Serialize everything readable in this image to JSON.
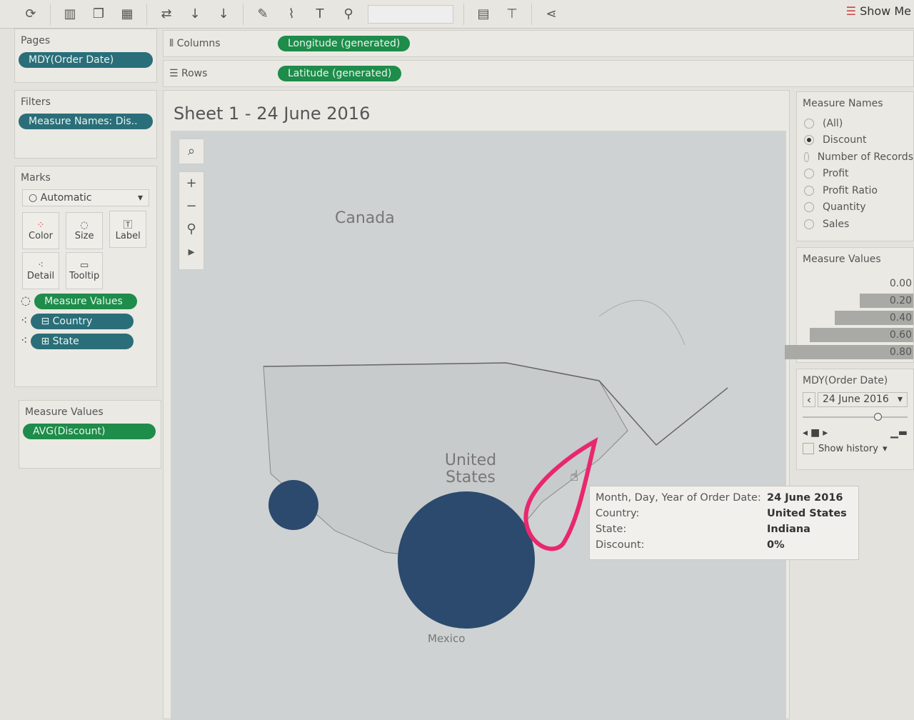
{
  "toolbar": {
    "icons": [
      "refresh-icon",
      "new-worksheet-icon",
      "duplicate-icon",
      "clear-sheet-icon",
      "swap-icon",
      "sort-asc-icon",
      "sort-desc-icon",
      "highlight-icon",
      "paperclip-icon",
      "text-icon",
      "pin-icon",
      "chart-type-icon",
      "presentation-icon",
      "share-icon"
    ],
    "show_me": "Show Me"
  },
  "pages": {
    "title": "Pages",
    "pill": "MDY(Order Date)"
  },
  "filters": {
    "title": "Filters",
    "pill": "Measure Names: Dis.."
  },
  "marks": {
    "title": "Marks",
    "type": "Automatic",
    "buttons": [
      "Color",
      "Size",
      "Label",
      "Detail",
      "Tooltip"
    ],
    "pills": [
      "Measure Values",
      "Country",
      "State"
    ]
  },
  "measure_values_card": {
    "title": "Measure Values",
    "pill": "AVG(Discount)"
  },
  "shelves": {
    "columns_label": "Columns",
    "columns_pill": "Longitude (generated)",
    "rows_label": "Rows",
    "rows_pill": "Latitude (generated)"
  },
  "sheet": {
    "title": "Sheet 1 - 24 June 2016"
  },
  "map": {
    "labels": [
      "Canada",
      "United States",
      "Mexico"
    ]
  },
  "tooltip": {
    "rows": [
      {
        "k": "Month, Day, Year of Order Date:",
        "v": "24 June 2016"
      },
      {
        "k": "Country:",
        "v": "United States"
      },
      {
        "k": "State:",
        "v": "Indiana"
      },
      {
        "k": "Discount:",
        "v": "0%"
      }
    ]
  },
  "measure_names": {
    "title": "Measure Names",
    "options": [
      "(All)",
      "Discount",
      "Number of Records",
      "Profit",
      "Profit Ratio",
      "Quantity",
      "Sales"
    ],
    "selected": "Discount"
  },
  "measure_legend": {
    "title": "Measure Values",
    "values": [
      "0.00",
      "0.20",
      "0.40",
      "0.60",
      "0.80"
    ]
  },
  "page_control": {
    "title": "MDY(Order Date)",
    "value": "24 June 2016",
    "show_history": "Show history"
  },
  "colors": {
    "mark": "#2b4a6e",
    "annotation": "#e8286e"
  }
}
